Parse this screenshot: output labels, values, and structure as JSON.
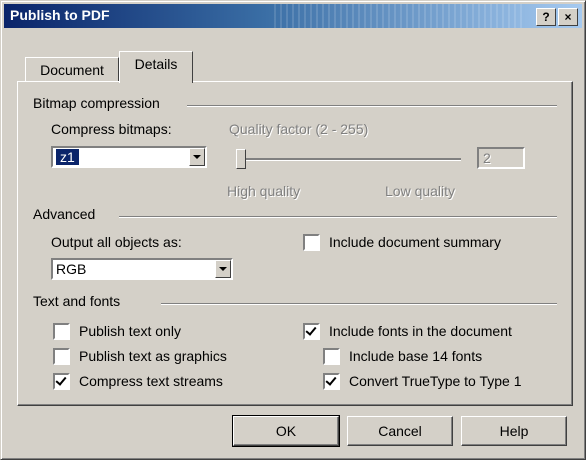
{
  "window": {
    "title": "Publish to PDF",
    "help_label": "?",
    "close_label": "×"
  },
  "tabs": [
    {
      "label": "Document",
      "active": false
    },
    {
      "label": "Details",
      "active": true
    }
  ],
  "bitmap": {
    "group_label": "Bitmap compression",
    "compress_label": "Compress bitmaps:",
    "compress_value": "z1",
    "quality_label": "Quality factor (2 - 255)",
    "quality_value": "2",
    "high_label": "High quality",
    "low_label": "Low quality"
  },
  "advanced": {
    "group_label": "Advanced",
    "output_label": "Output all objects as:",
    "output_value": "RGB",
    "summary_label": "Include document summary",
    "summary_checked": false
  },
  "text_fonts": {
    "group_label": "Text and fonts",
    "publish_text_only": {
      "label": "Publish text only",
      "checked": false
    },
    "publish_as_graphics": {
      "label": "Publish text as graphics",
      "checked": false
    },
    "compress_streams": {
      "label": "Compress text streams",
      "checked": true
    },
    "include_fonts": {
      "label": "Include fonts in the document",
      "checked": true
    },
    "base14": {
      "label": "Include base 14 fonts",
      "checked": false
    },
    "convert_truetype": {
      "label": "Convert TrueType to Type 1",
      "checked": true
    }
  },
  "buttons": {
    "ok": "OK",
    "cancel": "Cancel",
    "help": "Help"
  }
}
